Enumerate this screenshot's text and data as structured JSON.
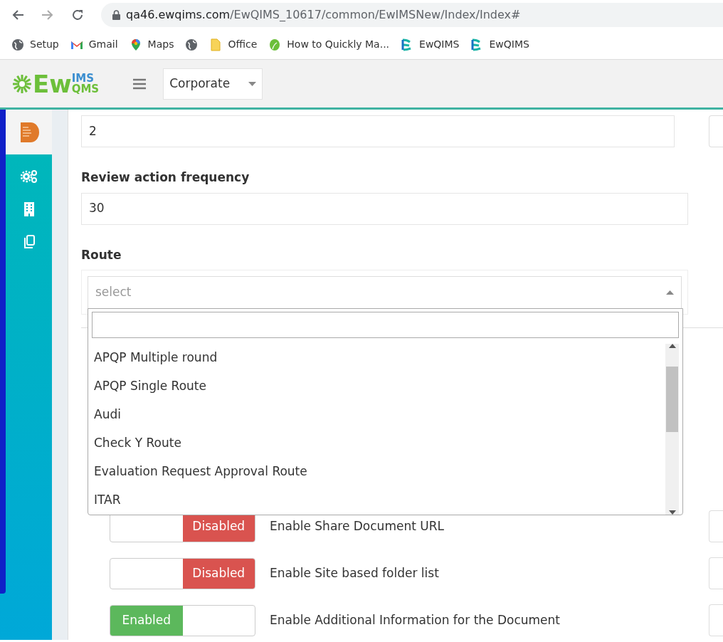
{
  "browser": {
    "url_host": "qa46.ewqims.com",
    "url_path": "/EwQIMS_10617/common/EwIMSNew/Index/Index#",
    "bookmarks": [
      {
        "label": "Setup",
        "kind": "globe"
      },
      {
        "label": "Gmail",
        "kind": "gmail"
      },
      {
        "label": "Maps",
        "kind": "maps"
      },
      {
        "kind": "globe"
      },
      {
        "label": "Office",
        "kind": "folder"
      },
      {
        "label": "How to Quickly Ma...",
        "kind": "leaf"
      },
      {
        "label": "EwQIMS",
        "kind": "ew"
      },
      {
        "label": "EwQIMS",
        "kind": "ew"
      }
    ]
  },
  "header": {
    "logo": {
      "main": "Ew",
      "top": "IMS",
      "bottom": "QMS"
    },
    "site_select": "Corporate"
  },
  "sidebar": {
    "items": [
      {
        "kind": "document",
        "selected": true
      },
      {
        "kind": "gears",
        "selected": false
      },
      {
        "kind": "building",
        "selected": false
      },
      {
        "kind": "copy",
        "selected": false
      }
    ]
  },
  "form": {
    "fields": [
      {
        "value": "2"
      },
      {
        "label": "Review action frequency",
        "value": "30"
      }
    ],
    "route": {
      "label": "Route",
      "placeholder": "select",
      "expanded": true,
      "options": [
        "APQP Multiple round",
        "APQP Single Route",
        "Audi",
        "Check Y Route",
        "Evaluation Request Approval Route",
        "ITAR"
      ]
    },
    "toggles": [
      {
        "label": "Enable Share Document URL",
        "on": false,
        "text": "Disabled"
      },
      {
        "label": "Enable Site based folder list",
        "on": false,
        "text": "Disabled"
      },
      {
        "label": "Enable Additional Information for the Document",
        "on": true,
        "text": "Enabled"
      }
    ]
  }
}
